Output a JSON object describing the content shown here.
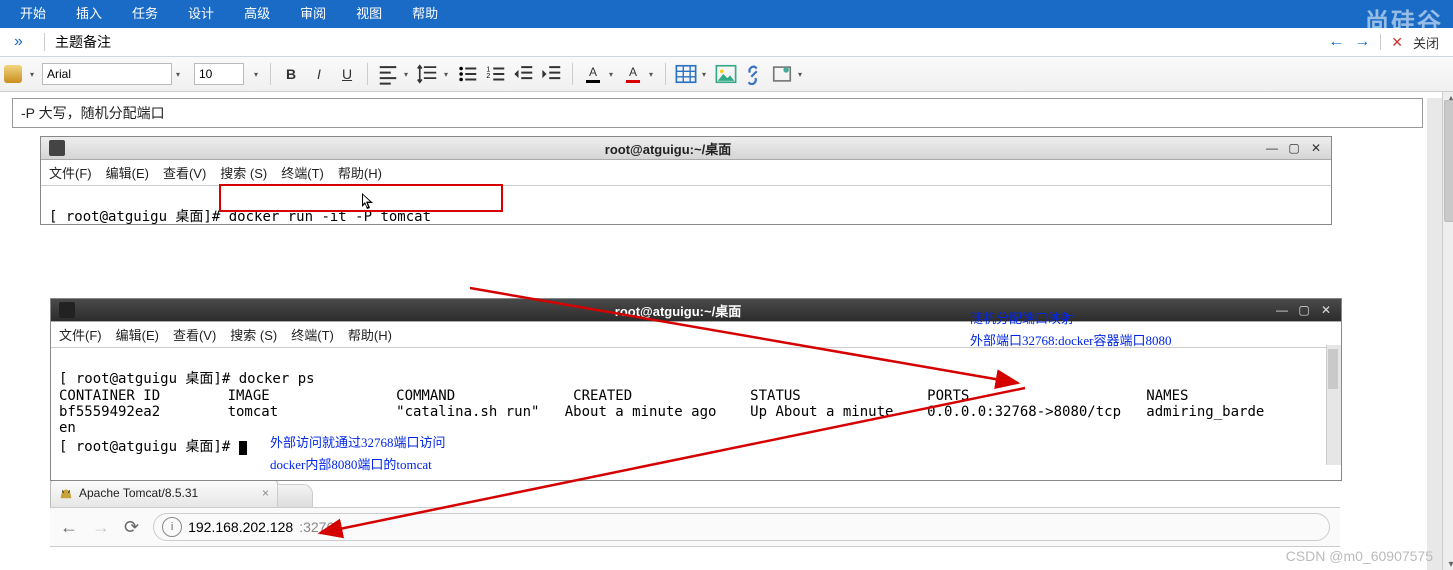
{
  "menu": {
    "items": [
      "开始",
      "插入",
      "任务",
      "设计",
      "高级",
      "审阅",
      "视图",
      "帮助"
    ]
  },
  "second_row": {
    "topic_label": "主题备注",
    "close_label": "关闭"
  },
  "toolbar": {
    "font_name": "Arial",
    "font_size": "10"
  },
  "note": {
    "text": "-P 大写，随机分配端口"
  },
  "terminal1": {
    "title": "root@atguigu:~/桌面",
    "menu": [
      "文件(F)",
      "编辑(E)",
      "查看(V)",
      "搜索 (S)",
      "终端(T)",
      "帮助(H)"
    ],
    "prompt": "[ root@atguigu 桌面]#",
    "command": "docker run -it -P tomcat"
  },
  "terminal2": {
    "title": "root@atguigu:~/桌面",
    "menu": [
      "文件(F)",
      "编辑(E)",
      "查看(V)",
      "搜索 (S)",
      "终端(T)",
      "帮助(H)"
    ],
    "line1": "[ root@atguigu 桌面]# docker ps",
    "header": "CONTAINER ID        IMAGE               COMMAND              CREATED              STATUS               PORTS                     NAMES",
    "row": "bf5559492ea2        tomcat              \"catalina.sh run\"   About a minute ago    Up About a minute    0.0.0.0:32768->8080/tcp   admiring_barde",
    "line3": "en",
    "line4_prompt": "[ root@atguigu 桌面]# "
  },
  "annotations": {
    "right1": "随机分配端口映射",
    "right2": "外部端口32768:docker容器端口8080",
    "mid1": "外部访问就通过32768端口访问",
    "mid2": "docker内部8080端口的tomcat"
  },
  "browser": {
    "tab_title": "Apache Tomcat/8.5.31",
    "url_host": "192.168.202.128",
    "url_port": ":32768"
  },
  "watermark": "尚硅谷",
  "csdn": "CSDN @m0_60907575"
}
